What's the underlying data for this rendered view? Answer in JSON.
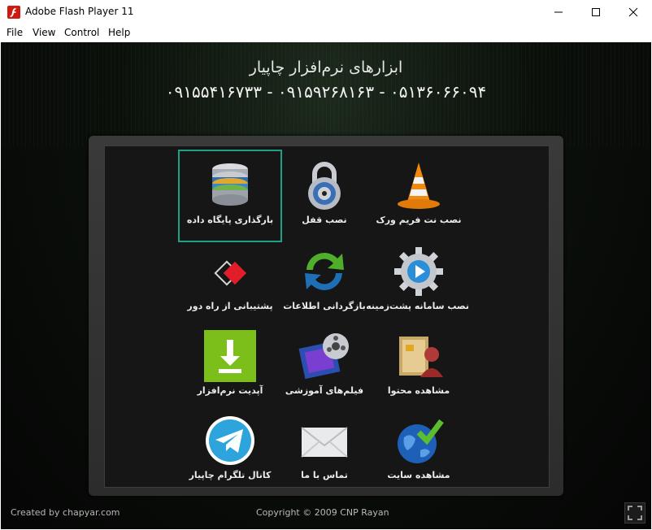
{
  "window": {
    "title": "Adobe Flash Player 11",
    "icon": "flash-icon",
    "controls": {
      "minimize": "—",
      "maximize": "☐",
      "close": "✕"
    }
  },
  "menu": {
    "items": [
      "File",
      "View",
      "Control",
      "Help"
    ]
  },
  "header": {
    "title": "ابزارهای نرم‌افزار چاپیار",
    "phones": "۰۵۱۳۶۰۶۶۰۹۴ - ۰۹۱۵۹۲۶۸۱۶۳ - ۰۹۱۵۵۴۱۶۷۳۳"
  },
  "tiles": [
    {
      "label": "بارگذاری پایگاه داده",
      "icon": "database-icon",
      "selected": true
    },
    {
      "label": "نصب قفل",
      "icon": "padlock-icon",
      "selected": false
    },
    {
      "label": "نصب نت فریم ورک",
      "icon": "traffic-cone-icon",
      "selected": false
    },
    {
      "label": "پشتیبانی از راه دور",
      "icon": "remote-support-icon",
      "selected": false
    },
    {
      "label": "بازگردانی اطلاعات",
      "icon": "sync-arrows-icon",
      "selected": false
    },
    {
      "label": "نصب سامانه پشت‌زمینه",
      "icon": "gear-play-icon",
      "selected": false
    },
    {
      "label": "آپدیت نرم‌افزار",
      "icon": "download-icon",
      "selected": false
    },
    {
      "label": "فیلم‌های آموزشی",
      "icon": "film-reel-icon",
      "selected": false
    },
    {
      "label": "مشاهده محتوا",
      "icon": "folder-user-icon",
      "selected": false
    },
    {
      "label": "کانال تلگرام چاپیار",
      "icon": "telegram-icon",
      "selected": false
    },
    {
      "label": "تماس با ما",
      "icon": "envelope-icon",
      "selected": false
    },
    {
      "label": "مشاهده سایت",
      "icon": "globe-check-icon",
      "selected": false
    }
  ],
  "footer": {
    "created_by": "Created by chapyar.com",
    "copyright": "Copyright © 2009 CNP Rayan"
  },
  "colors": {
    "selection": "#1ea089",
    "background": "#0b100b",
    "panel": "#161616"
  }
}
